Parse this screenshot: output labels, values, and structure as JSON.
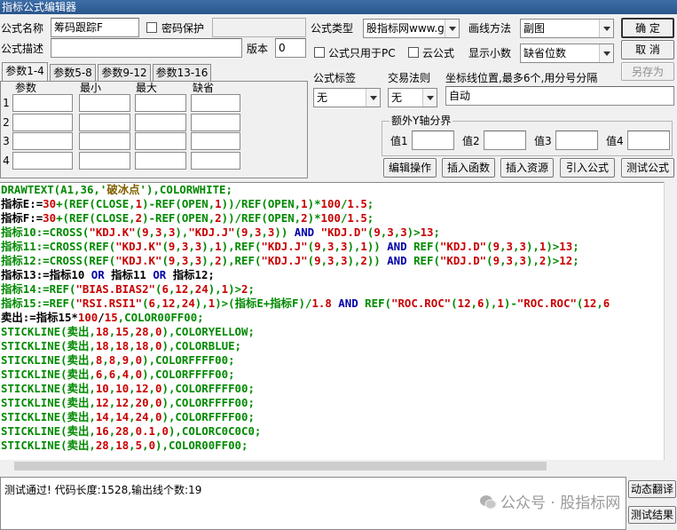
{
  "window": {
    "title": "指标公式编辑器"
  },
  "form": {
    "name_label": "公式名称",
    "name_value": "筹码跟踪F",
    "password_label": "密码保护",
    "desc_label": "公式描述",
    "version_label": "版本",
    "version_value": "0",
    "type_label": "公式类型",
    "type_value": "股指标网www.g",
    "draw_label": "画线方法",
    "draw_value": "副图",
    "pc_only_label": "公式只用于PC",
    "cloud_label": "云公式",
    "decimals_label": "显示小数",
    "decimals_value": "缺省位数"
  },
  "buttons": {
    "ok": "确  定",
    "cancel": "取  消",
    "save_as": "另存为"
  },
  "tabs": [
    "参数1-4",
    "参数5-8",
    "参数9-12",
    "参数13-16"
  ],
  "params": {
    "headers": [
      "参数",
      "最小",
      "最大",
      "缺省"
    ],
    "rows": [
      "1",
      "2",
      "3",
      "4"
    ]
  },
  "right": {
    "tag_label": "公式标签",
    "tag_value": "无",
    "rule_label": "交易法则",
    "rule_value": "无",
    "coord_label": "坐标线位置,最多6个,用分号分隔",
    "coord_value": "自动",
    "yaxis_title": "额外Y轴分界",
    "values": [
      "值1",
      "值2",
      "值3",
      "值4"
    ]
  },
  "actions": [
    "编辑操作",
    "插入函数",
    "插入资源",
    "引入公式",
    "测试公式"
  ],
  "code_colors": {
    "green": "#008a00",
    "navy": "#0000a8",
    "red": "#c80000",
    "olive": "#806000",
    "black": "#000000"
  },
  "code": [
    [
      [
        "DRAWTEXT(A1,36,'",
        "green"
      ],
      [
        "破冰点",
        "olive"
      ],
      [
        "'),COLORWHITE;",
        "green"
      ]
    ],
    [
      [
        "指标E:=",
        "black"
      ],
      [
        "30",
        "red"
      ],
      [
        "+(REF(CLOSE,",
        "green"
      ],
      [
        "1",
        "red"
      ],
      [
        ")-REF(OPEN,",
        "green"
      ],
      [
        "1",
        "red"
      ],
      [
        "))/REF(OPEN,",
        "green"
      ],
      [
        "1",
        "red"
      ],
      [
        ")*",
        "green"
      ],
      [
        "100",
        "red"
      ],
      [
        "/",
        "green"
      ],
      [
        "1.5",
        "red"
      ],
      [
        ";",
        "green"
      ]
    ],
    [
      [
        "指标F:=",
        "black"
      ],
      [
        "30",
        "red"
      ],
      [
        "+(REF(CLOSE,",
        "green"
      ],
      [
        "2",
        "red"
      ],
      [
        ")-REF(OPEN,",
        "green"
      ],
      [
        "2",
        "red"
      ],
      [
        "))/REF(OPEN,",
        "green"
      ],
      [
        "2",
        "red"
      ],
      [
        ")*",
        "green"
      ],
      [
        "100",
        "red"
      ],
      [
        "/",
        "green"
      ],
      [
        "1.5",
        "red"
      ],
      [
        ";",
        "green"
      ]
    ],
    [
      [
        "指标10:=CROSS(",
        "green"
      ],
      [
        "\"KDJ.K\"",
        "red"
      ],
      [
        "(",
        "green"
      ],
      [
        "9",
        "red"
      ],
      [
        ",",
        "green"
      ],
      [
        "3",
        "red"
      ],
      [
        ",",
        "green"
      ],
      [
        "3",
        "red"
      ],
      [
        "),",
        "green"
      ],
      [
        "\"KDJ.J\"",
        "red"
      ],
      [
        "(",
        "green"
      ],
      [
        "9",
        "red"
      ],
      [
        ",",
        "green"
      ],
      [
        "3",
        "red"
      ],
      [
        ",",
        "green"
      ],
      [
        "3",
        "red"
      ],
      [
        ")) ",
        "green"
      ],
      [
        "AND",
        "navy"
      ],
      [
        " ",
        "green"
      ],
      [
        "\"KDJ.D\"",
        "red"
      ],
      [
        "(",
        "green"
      ],
      [
        "9",
        "red"
      ],
      [
        ",",
        "green"
      ],
      [
        "3",
        "red"
      ],
      [
        ",",
        "green"
      ],
      [
        "3",
        "red"
      ],
      [
        ")>",
        "green"
      ],
      [
        "13",
        "red"
      ],
      [
        ";",
        "green"
      ]
    ],
    [
      [
        "指标11:=CROSS(REF(",
        "green"
      ],
      [
        "\"KDJ.K\"",
        "red"
      ],
      [
        "(",
        "green"
      ],
      [
        "9",
        "red"
      ],
      [
        ",",
        "green"
      ],
      [
        "3",
        "red"
      ],
      [
        ",",
        "green"
      ],
      [
        "3",
        "red"
      ],
      [
        "),",
        "green"
      ],
      [
        "1",
        "red"
      ],
      [
        "),REF(",
        "green"
      ],
      [
        "\"KDJ.J\"",
        "red"
      ],
      [
        "(",
        "green"
      ],
      [
        "9",
        "red"
      ],
      [
        ",",
        "green"
      ],
      [
        "3",
        "red"
      ],
      [
        ",",
        "green"
      ],
      [
        "3",
        "red"
      ],
      [
        "),",
        "green"
      ],
      [
        "1",
        "red"
      ],
      [
        ")) ",
        "green"
      ],
      [
        "AND",
        "navy"
      ],
      [
        " REF(",
        "green"
      ],
      [
        "\"KDJ.D\"",
        "red"
      ],
      [
        "(",
        "green"
      ],
      [
        "9",
        "red"
      ],
      [
        ",",
        "green"
      ],
      [
        "3",
        "red"
      ],
      [
        ",",
        "green"
      ],
      [
        "3",
        "red"
      ],
      [
        "),",
        "green"
      ],
      [
        "1",
        "red"
      ],
      [
        ")>",
        "green"
      ],
      [
        "13",
        "red"
      ],
      [
        ";",
        "green"
      ]
    ],
    [
      [
        "指标12:=CROSS(REF(",
        "green"
      ],
      [
        "\"KDJ.K\"",
        "red"
      ],
      [
        "(",
        "green"
      ],
      [
        "9",
        "red"
      ],
      [
        ",",
        "green"
      ],
      [
        "3",
        "red"
      ],
      [
        ",",
        "green"
      ],
      [
        "3",
        "red"
      ],
      [
        "),",
        "green"
      ],
      [
        "2",
        "red"
      ],
      [
        "),REF(",
        "green"
      ],
      [
        "\"KDJ.J\"",
        "red"
      ],
      [
        "(",
        "green"
      ],
      [
        "9",
        "red"
      ],
      [
        ",",
        "green"
      ],
      [
        "3",
        "red"
      ],
      [
        ",",
        "green"
      ],
      [
        "3",
        "red"
      ],
      [
        "),",
        "green"
      ],
      [
        "2",
        "red"
      ],
      [
        ")) ",
        "green"
      ],
      [
        "AND",
        "navy"
      ],
      [
        " REF(",
        "green"
      ],
      [
        "\"KDJ.D\"",
        "red"
      ],
      [
        "(",
        "green"
      ],
      [
        "9",
        "red"
      ],
      [
        ",",
        "green"
      ],
      [
        "3",
        "red"
      ],
      [
        ",",
        "green"
      ],
      [
        "3",
        "red"
      ],
      [
        "),",
        "green"
      ],
      [
        "2",
        "red"
      ],
      [
        ")>",
        "green"
      ],
      [
        "12",
        "red"
      ],
      [
        ";",
        "green"
      ]
    ],
    [
      [
        "指标13:=指标10 ",
        "black"
      ],
      [
        "OR",
        "navy"
      ],
      [
        " 指标11 ",
        "black"
      ],
      [
        "OR",
        "navy"
      ],
      [
        " 指标12;",
        "black"
      ]
    ],
    [
      [
        "指标14:=REF(",
        "green"
      ],
      [
        "\"BIAS.BIAS2\"",
        "red"
      ],
      [
        "(",
        "green"
      ],
      [
        "6",
        "red"
      ],
      [
        ",",
        "green"
      ],
      [
        "12",
        "red"
      ],
      [
        ",",
        "green"
      ],
      [
        "24",
        "red"
      ],
      [
        "),",
        "green"
      ],
      [
        "1",
        "red"
      ],
      [
        ")>",
        "green"
      ],
      [
        "2",
        "red"
      ],
      [
        ";",
        "green"
      ]
    ],
    [
      [
        "指标15:=REF(",
        "green"
      ],
      [
        "\"RSI.RSI1\"",
        "red"
      ],
      [
        "(",
        "green"
      ],
      [
        "6",
        "red"
      ],
      [
        ",",
        "green"
      ],
      [
        "12",
        "red"
      ],
      [
        ",",
        "green"
      ],
      [
        "24",
        "red"
      ],
      [
        "),",
        "green"
      ],
      [
        "1",
        "red"
      ],
      [
        ")>(指标E+指标F)/",
        "green"
      ],
      [
        "1.8",
        "red"
      ],
      [
        " ",
        "green"
      ],
      [
        "AND",
        "navy"
      ],
      [
        " REF(",
        "green"
      ],
      [
        "\"ROC.ROC\"",
        "red"
      ],
      [
        "(",
        "green"
      ],
      [
        "12",
        "red"
      ],
      [
        ",",
        "green"
      ],
      [
        "6",
        "red"
      ],
      [
        "),",
        "green"
      ],
      [
        "1",
        "red"
      ],
      [
        ")-",
        "green"
      ],
      [
        "\"ROC.ROC\"",
        "red"
      ],
      [
        "(",
        "green"
      ],
      [
        "12",
        "red"
      ],
      [
        ",",
        "green"
      ],
      [
        "6",
        "red"
      ]
    ],
    [
      [
        "卖出:=指标15*",
        "black"
      ],
      [
        "100",
        "red"
      ],
      [
        "/",
        "black"
      ],
      [
        "15",
        "red"
      ],
      [
        ",COLOR00FF00;",
        "green"
      ]
    ],
    [
      [
        "STICKLINE(卖出,",
        "green"
      ],
      [
        "18",
        "red"
      ],
      [
        ",",
        "green"
      ],
      [
        "15",
        "red"
      ],
      [
        ",",
        "green"
      ],
      [
        "28",
        "red"
      ],
      [
        ",",
        "green"
      ],
      [
        "0",
        "red"
      ],
      [
        "),COLORYELLOW;",
        "green"
      ]
    ],
    [
      [
        "STICKLINE(卖出,",
        "green"
      ],
      [
        "18",
        "red"
      ],
      [
        ",",
        "green"
      ],
      [
        "18",
        "red"
      ],
      [
        ",",
        "green"
      ],
      [
        "18",
        "red"
      ],
      [
        ",",
        "green"
      ],
      [
        "0",
        "red"
      ],
      [
        "),COLORBLUE;",
        "green"
      ]
    ],
    [
      [
        "STICKLINE(卖出,",
        "green"
      ],
      [
        "8",
        "red"
      ],
      [
        ",",
        "green"
      ],
      [
        "8",
        "red"
      ],
      [
        ",",
        "green"
      ],
      [
        "9",
        "red"
      ],
      [
        ",",
        "green"
      ],
      [
        "0",
        "red"
      ],
      [
        "),COLORFFFF00;",
        "green"
      ]
    ],
    [
      [
        "STICKLINE(卖出,",
        "green"
      ],
      [
        "6",
        "red"
      ],
      [
        ",",
        "green"
      ],
      [
        "6",
        "red"
      ],
      [
        ",",
        "green"
      ],
      [
        "4",
        "red"
      ],
      [
        ",",
        "green"
      ],
      [
        "0",
        "red"
      ],
      [
        "),COLORFFFF00;",
        "green"
      ]
    ],
    [
      [
        "STICKLINE(卖出,",
        "green"
      ],
      [
        "10",
        "red"
      ],
      [
        ",",
        "green"
      ],
      [
        "10",
        "red"
      ],
      [
        ",",
        "green"
      ],
      [
        "12",
        "red"
      ],
      [
        ",",
        "green"
      ],
      [
        "0",
        "red"
      ],
      [
        "),COLORFFFF00;",
        "green"
      ]
    ],
    [
      [
        "STICKLINE(卖出,",
        "green"
      ],
      [
        "12",
        "red"
      ],
      [
        ",",
        "green"
      ],
      [
        "12",
        "red"
      ],
      [
        ",",
        "green"
      ],
      [
        "20",
        "red"
      ],
      [
        ",",
        "green"
      ],
      [
        "0",
        "red"
      ],
      [
        "),COLORFFFF00;",
        "green"
      ]
    ],
    [
      [
        "STICKLINE(卖出,",
        "green"
      ],
      [
        "14",
        "red"
      ],
      [
        ",",
        "green"
      ],
      [
        "14",
        "red"
      ],
      [
        ",",
        "green"
      ],
      [
        "24",
        "red"
      ],
      [
        ",",
        "green"
      ],
      [
        "0",
        "red"
      ],
      [
        "),COLORFFFF00;",
        "green"
      ]
    ],
    [
      [
        "STICKLINE(卖出,",
        "green"
      ],
      [
        "16",
        "red"
      ],
      [
        ",",
        "green"
      ],
      [
        "28",
        "red"
      ],
      [
        ",",
        "green"
      ],
      [
        "0.1",
        "red"
      ],
      [
        ",",
        "green"
      ],
      [
        "0",
        "red"
      ],
      [
        "),COLORC0C0C0;",
        "green"
      ]
    ],
    [
      [
        "STICKLINE(卖出,",
        "green"
      ],
      [
        "28",
        "red"
      ],
      [
        ",",
        "green"
      ],
      [
        "18",
        "red"
      ],
      [
        ",",
        "green"
      ],
      [
        "5",
        "red"
      ],
      [
        ",",
        "green"
      ],
      [
        "0",
        "red"
      ],
      [
        "),COLOR00FF00;",
        "green"
      ]
    ]
  ],
  "status": {
    "text": "测试通过! 代码长度:1528,输出线个数:19"
  },
  "side_buttons": {
    "translate": "动态翻译",
    "result": "测试结果"
  },
  "watermark": "公众号 · 股指标网"
}
